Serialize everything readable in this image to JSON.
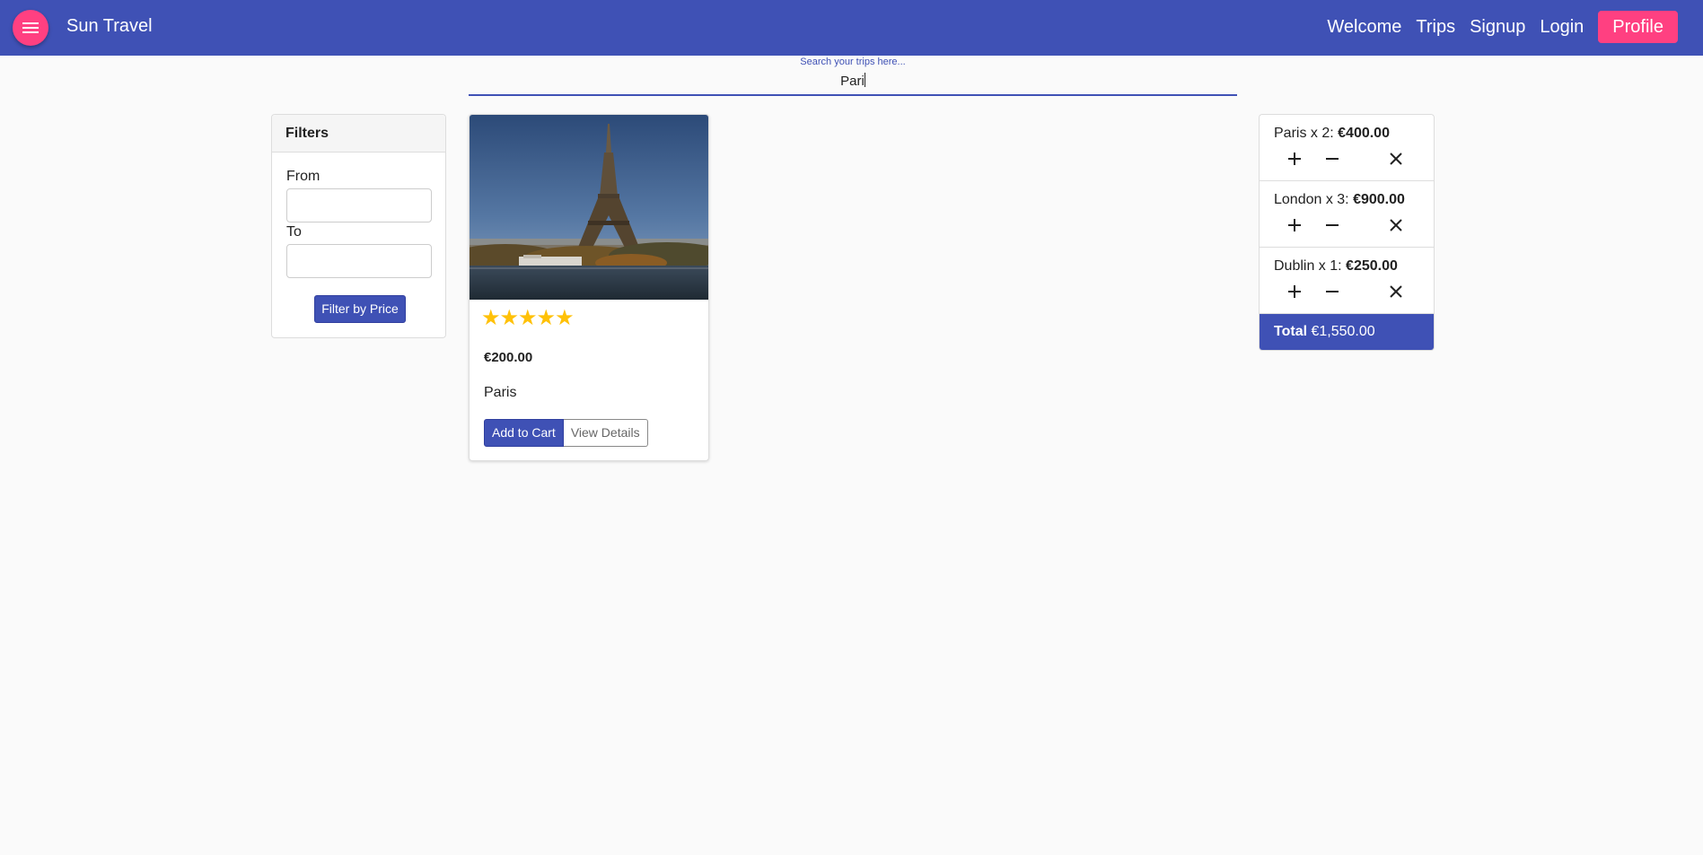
{
  "header": {
    "brand": "Sun Travel",
    "menu_icon": "menu-icon",
    "nav": {
      "welcome": "Welcome",
      "trips": "Trips",
      "signup": "Signup",
      "login": "Login",
      "profile": "Profile"
    },
    "colors": {
      "primary": "#3f51b5",
      "accent": "#ff4081"
    }
  },
  "search": {
    "placeholder": "Search your trips here...",
    "value": "Pari"
  },
  "filters": {
    "title": "Filters",
    "from_label": "From",
    "to_label": "To",
    "from_value": "",
    "to_value": "",
    "button": "Filter by Price"
  },
  "trips": [
    {
      "image": "eiffel-tower-photo",
      "rating": 5,
      "stars": "★★★★★",
      "price": "€200.00",
      "city": "Paris",
      "add_button": "Add to Cart",
      "details_button": "View Details"
    }
  ],
  "cart": {
    "items": [
      {
        "label": "Paris x 2: ",
        "amount": "€400.00"
      },
      {
        "label": "London x 3: ",
        "amount": "€900.00"
      },
      {
        "label": "Dublin x 1: ",
        "amount": "€250.00"
      }
    ],
    "total_label": "Total",
    "total_value": " €1,550.00",
    "icons": {
      "add": "plus-icon",
      "decrease": "minus-icon",
      "remove": "close-icon"
    }
  }
}
